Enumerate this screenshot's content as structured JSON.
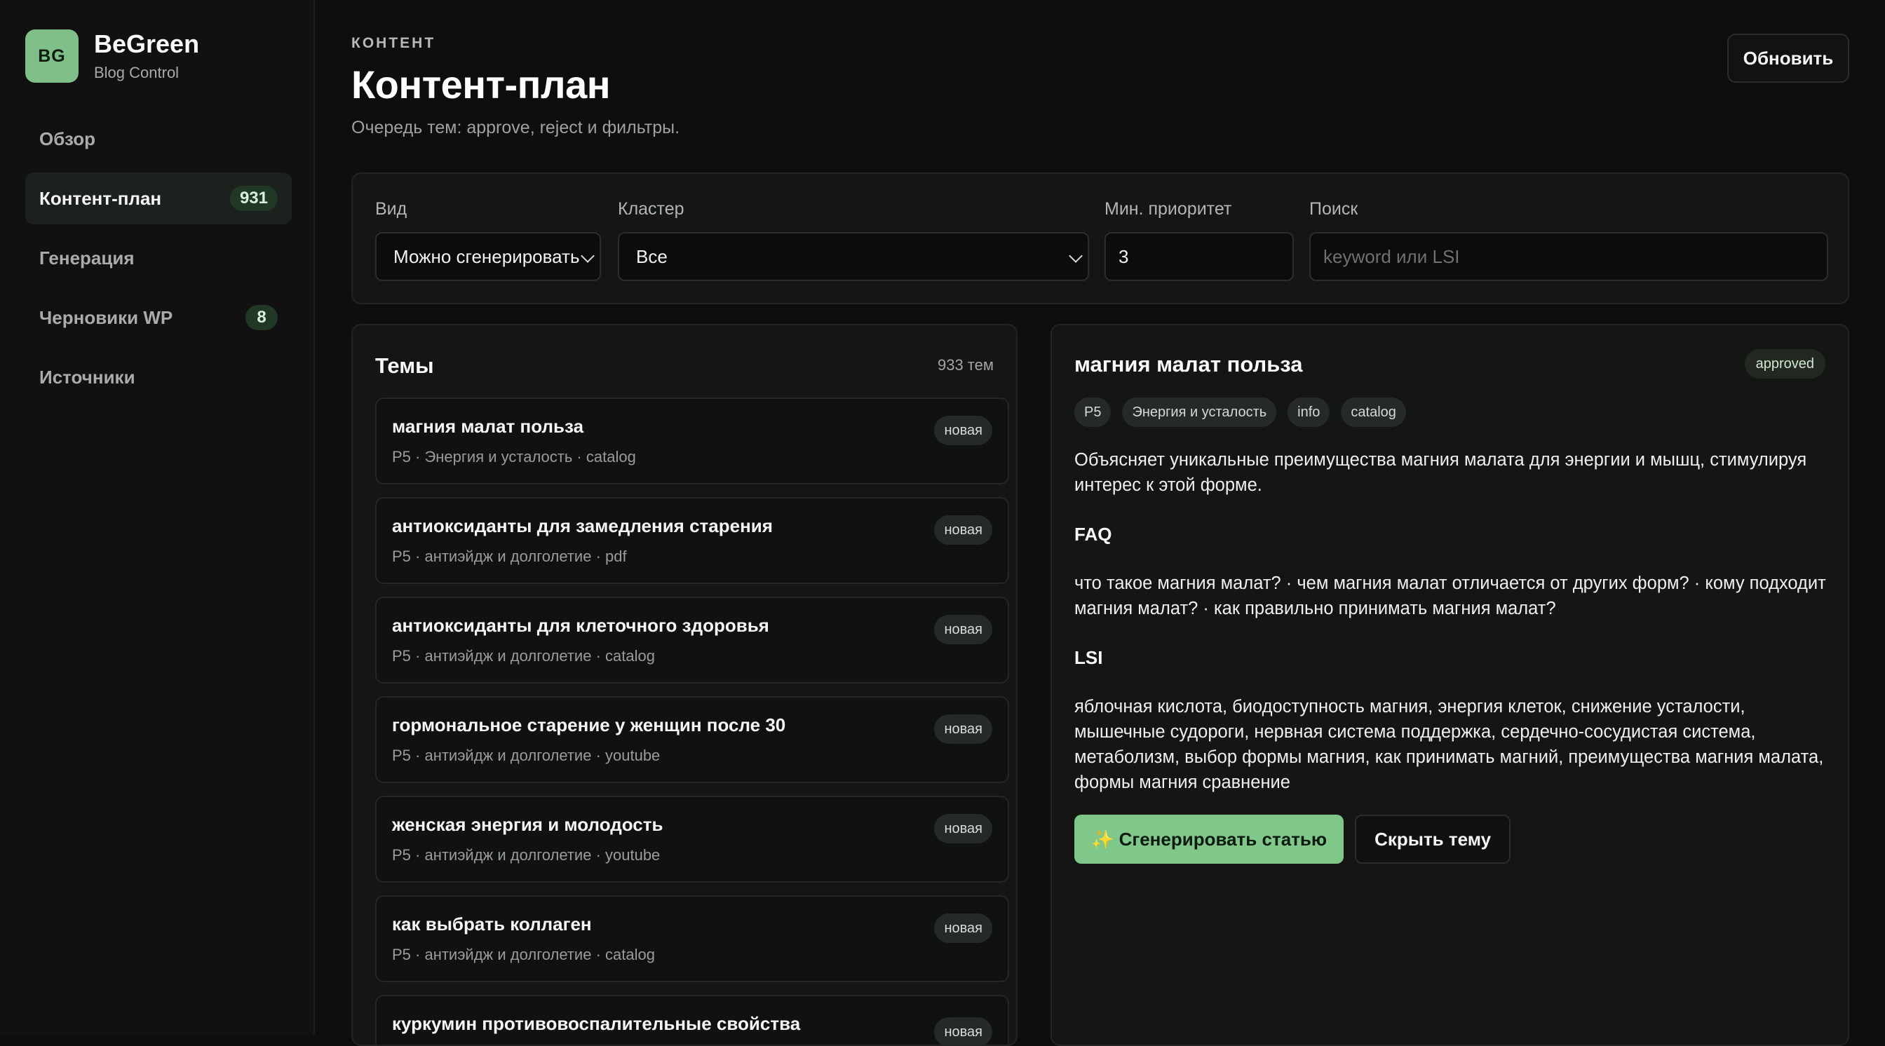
{
  "brand": {
    "logo": "BG",
    "name": "BeGreen",
    "subtitle": "Blog Control"
  },
  "sidebar": {
    "items": [
      {
        "label": "Обзор",
        "count": null
      },
      {
        "label": "Контент-план",
        "count": "931",
        "active": true
      },
      {
        "label": "Генерация",
        "count": null
      },
      {
        "label": "Черновики WP",
        "count": "8"
      },
      {
        "label": "Источники",
        "count": null
      }
    ]
  },
  "header": {
    "eyebrow": "КОНТЕНТ",
    "title": "Контент-план",
    "subtitle": "Очередь тем: approve, reject и фильтры.",
    "refresh_label": "Обновить"
  },
  "filters": {
    "view": {
      "label": "Вид",
      "value": "Можно сгенерировать"
    },
    "cluster": {
      "label": "Кластер",
      "value": "Все"
    },
    "min_priority": {
      "label": "Мин. приоритет",
      "value": "3"
    },
    "search": {
      "label": "Поиск",
      "placeholder": "keyword или LSI"
    }
  },
  "topics": {
    "title": "Темы",
    "count": "933 тем",
    "items": [
      {
        "title": "магния малат польза",
        "meta": "P5 · Энергия и усталость · catalog",
        "status": "новая"
      },
      {
        "title": "антиоксиданты для замедления старения",
        "meta": "P5 · антиэйдж и долголетие · pdf",
        "status": "новая"
      },
      {
        "title": "антиоксиданты для клеточного здоровья",
        "meta": "P5 · антиэйдж и долголетие · catalog",
        "status": "новая"
      },
      {
        "title": "гормональное старение у женщин после 30",
        "meta": "P5 · антиэйдж и долголетие · youtube",
        "status": "новая"
      },
      {
        "title": "женская энергия и молодость",
        "meta": "P5 · антиэйдж и долголетие · youtube",
        "status": "новая"
      },
      {
        "title": "как выбрать коллаген",
        "meta": "P5 · антиэйдж и долголетие · catalog",
        "status": "новая"
      },
      {
        "title": "куркумин противовоспалительные свойства",
        "meta": "",
        "status": "новая"
      }
    ]
  },
  "detail": {
    "title": "магния малат польза",
    "status": "approved",
    "tags": [
      "P5",
      "Энергия и усталость",
      "info",
      "catalog"
    ],
    "description": "Объясняет уникальные преимущества магния малата для энергии и мышц, стимулируя интерес к этой форме.",
    "faq_heading": "FAQ",
    "faq_text": "что такое магния малат? · чем магния малат отличается от других форм? · кому подходит магния малат? · как правильно принимать магния малат?",
    "lsi_heading": "LSI",
    "lsi_text": "яблочная кислота, биодоступность магния, энергия клеток, снижение усталости, мышечные судороги, нервная система поддержка, сердечно-сосудистая система, метаболизм, выбор формы магния, как принимать магний, преимущества магния малата, формы магния сравнение",
    "generate_label": "✨ Сгенерировать статью",
    "hide_label": "Скрыть тему"
  }
}
